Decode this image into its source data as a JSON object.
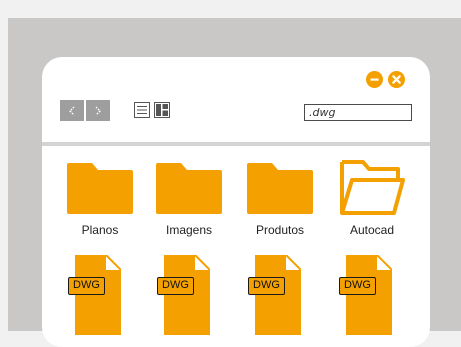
{
  "window": {
    "controls": {
      "minimize_icon": "minus-icon",
      "close_icon": "x-icon",
      "accent": "#f4a000"
    },
    "toolbar": {
      "back_icon": "chevron-left-icon",
      "forward_icon": "chevron-right-icon",
      "list_view_icon": "list-view-icon",
      "grid_view_icon": "grid-view-icon",
      "search_value": ".dwg"
    }
  },
  "folders": [
    {
      "label": "Planos",
      "state": "closed"
    },
    {
      "label": "Imagens",
      "state": "closed"
    },
    {
      "label": "Produtos",
      "state": "closed"
    },
    {
      "label": "Autocad",
      "state": "open"
    }
  ],
  "files": [
    {
      "badge": "DWG"
    },
    {
      "badge": "DWG"
    },
    {
      "badge": "DWG"
    },
    {
      "badge": "DWG"
    }
  ],
  "colors": {
    "accent": "#f4a000",
    "backdrop": "#c9c8c6",
    "nav_button": "#9e9e9e"
  }
}
